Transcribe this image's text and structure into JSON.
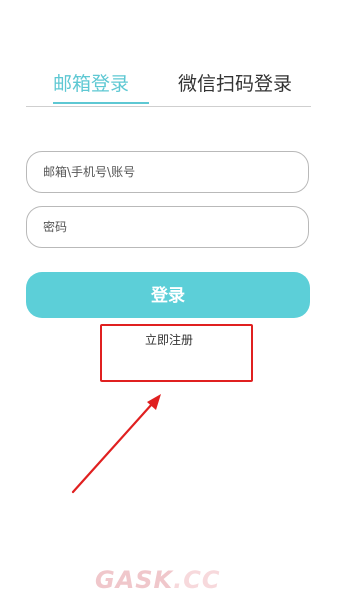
{
  "tabs": {
    "email_login": "邮箱登录",
    "wechat_login": "微信扫码登录"
  },
  "form": {
    "account_placeholder": "邮箱\\手机号\\账号",
    "password_placeholder": "密码",
    "login_label": "登录",
    "register_label": "立即注册"
  },
  "watermark": {
    "part1": "GASK",
    "part2": ".CC"
  },
  "colors": {
    "accent": "#5ccfd8",
    "highlight": "#e02020"
  },
  "annotations": {
    "arrow_icon": "red-arrow-icon",
    "highlight_icon": "red-box-highlight"
  }
}
